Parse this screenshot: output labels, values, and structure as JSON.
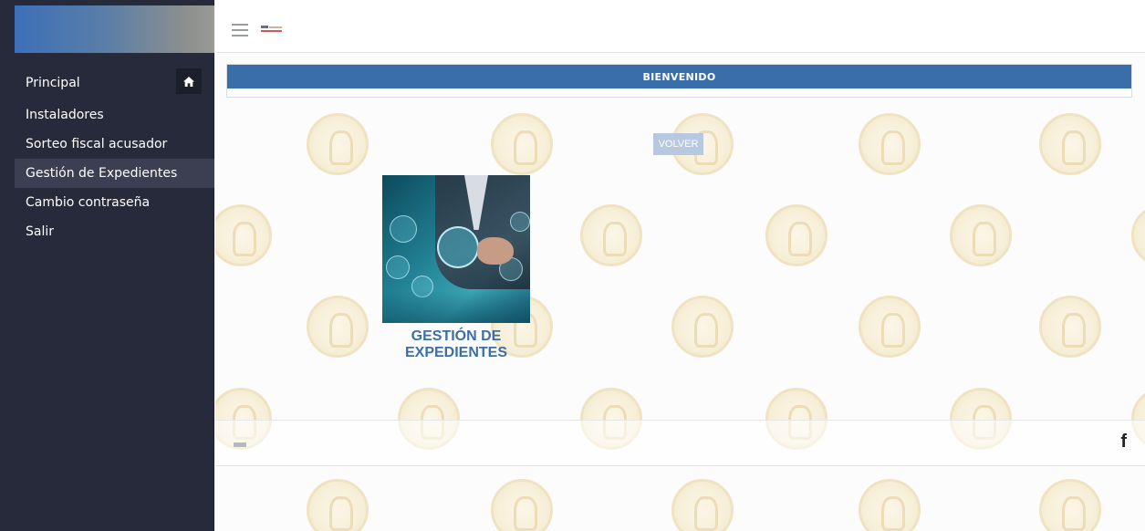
{
  "sidebar": {
    "items": [
      {
        "label": "Principal"
      },
      {
        "label": "Instaladores"
      },
      {
        "label": "Sorteo fiscal acusador"
      },
      {
        "label": "Gestión de Expedientes"
      },
      {
        "label": "Cambio contraseña"
      },
      {
        "label": "Salir"
      }
    ],
    "home_icon": "home-icon"
  },
  "topbar": {
    "menu_icon": "hamburger-icon"
  },
  "main": {
    "welcome": "BIENVENIDO",
    "back_button": "VOLVER",
    "module": {
      "title": "GESTIÓN DE EXPEDIENTES",
      "image_icon": "business-network-icon"
    }
  },
  "footer": {
    "social_icon": "facebook-icon",
    "social_label": "f"
  },
  "colors": {
    "sidebar_bg": "#272a3a",
    "accent_blue": "#3a6ea8",
    "active_item": "#3c3f52",
    "module_title": "#3c6fa6"
  }
}
